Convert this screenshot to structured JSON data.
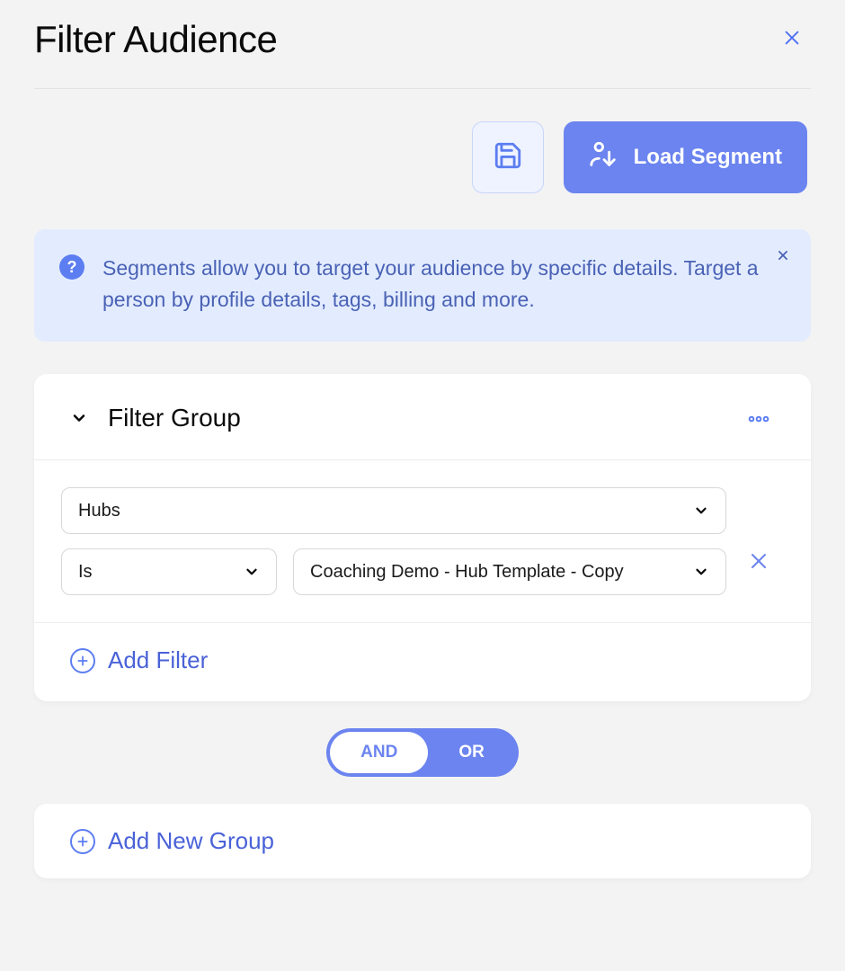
{
  "header": {
    "title": "Filter Audience"
  },
  "actions": {
    "load_segment_label": "Load Segment"
  },
  "info": {
    "text": "Segments allow you to target your audience by specific details. Target a person by profile details, tags, billing and more."
  },
  "filter_group": {
    "title": "Filter Group",
    "field_select": "Hubs",
    "operator_select": "Is",
    "value_select": "Coaching Demo - Hub Template - Copy",
    "add_filter_label": "Add Filter"
  },
  "logic_toggle": {
    "and_label": "AND",
    "or_label": "OR",
    "active": "AND"
  },
  "add_group": {
    "label": "Add New Group"
  }
}
